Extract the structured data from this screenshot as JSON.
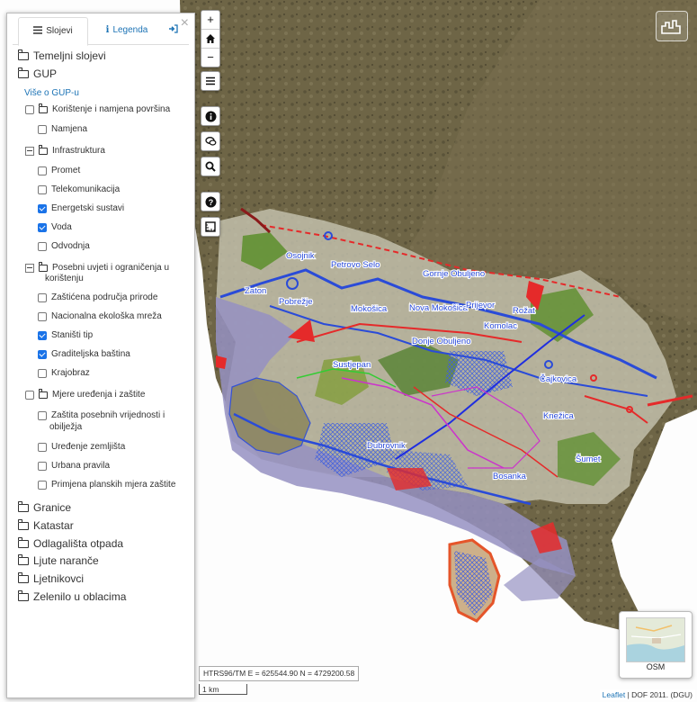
{
  "panel": {
    "tabs": {
      "layers": "Slojevi",
      "legend": "Legenda"
    },
    "close": "×",
    "tree": {
      "temeljni": "Temeljni slojevi",
      "gup": "GUP",
      "gup_link": "Više o GUP-u",
      "g1": "Korištenje i namjena površina",
      "g1_items": [
        "Namjena"
      ],
      "g2": "Infrastruktura",
      "g2_items": [
        "Promet",
        "Telekomunikacija",
        "Energetski sustavi",
        "Voda",
        "Odvodnja"
      ],
      "g2_checked": [
        false,
        false,
        true,
        true,
        false
      ],
      "g3_line1": "Posebni uvjeti i ograničenja u",
      "g3_line2": "korištenju",
      "g3_items": [
        "Zaštićena područja prirode",
        "Nacionalna ekološka mreža",
        "Staništi tip",
        "Graditeljska baština",
        "Krajobraz"
      ],
      "g3_checked": [
        false,
        false,
        true,
        true,
        false
      ],
      "g4": "Mjere uređenja i zaštite",
      "g4_item1_line1": "Zaštita posebnih vrijednosti i",
      "g4_item1_line2": "obilježja",
      "g4_items": [
        "Uređenje zemljišta",
        "Urbana pravila",
        "Primjena planskih mjera zaštite"
      ],
      "others": [
        "Granice",
        "Katastar",
        "Odlagališta otpada",
        "Ljute naranče",
        "Ljetnikovci",
        "Zelenilo u oblacima"
      ]
    }
  },
  "controls": {
    "zoom_in": "+",
    "zoom_out": "−"
  },
  "place_labels": [
    "Osojnik",
    "Petrovo Selo",
    "Gornje Obuljeno",
    "Zaton",
    "Pobrežje",
    "Mokošica",
    "Nova Mokošica",
    "Prijevor",
    "Rožat",
    "Komolac",
    "Donje Obuljeno",
    "Sustjepan",
    "Čajkovica",
    "Knežica",
    "Dubrovnik",
    "Šumet",
    "Bosanka"
  ],
  "coords_text": "HTRS96/TM E = 625544.90 N = 4729200.58",
  "scale_text": "1 km",
  "minimap_label": "OSM",
  "attribution": {
    "link": "Leaflet",
    "text": " | DOF 2011. (DGU)"
  },
  "colors": {
    "sea": "#ffffff",
    "land": "#6b6243",
    "overlay": "#bcbaa6",
    "plan_blue": "#2a4bd8",
    "plan_red": "#e52a2a",
    "link": "#1c73b5",
    "checkbox": "#1a73e8"
  }
}
